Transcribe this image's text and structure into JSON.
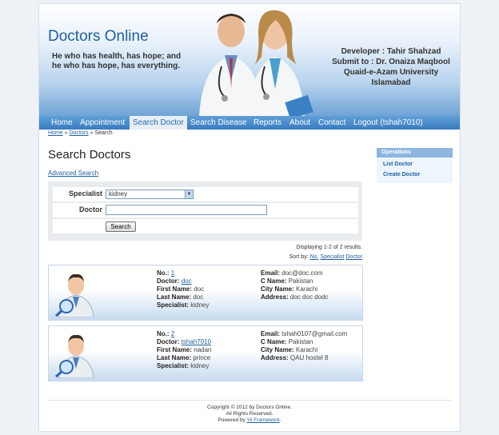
{
  "header": {
    "title": "Doctors Online",
    "motto_line1": "He who has health, has hope; and",
    "motto_line2": "he who has hope, has everything.",
    "developer": "Developer : Tahir Shahzad",
    "submit": "Submit to : Dr. Onaiza Maqbool",
    "university": "Quaid-e-Azam University",
    "city": "Islamabad"
  },
  "nav": [
    {
      "label": "Home"
    },
    {
      "label": "Appointment"
    },
    {
      "label": "Search Doctor",
      "active": true
    },
    {
      "label": "Search Disease"
    },
    {
      "label": "Reports"
    },
    {
      "label": "About"
    },
    {
      "label": "Contact"
    },
    {
      "label": "Logout (tshah7010)"
    }
  ],
  "breadcrumb": {
    "home": "Home",
    "sep1": "»",
    "doctors": "Doctors",
    "sep2": "»",
    "current": "Search"
  },
  "page_title": "Search Doctors",
  "advanced_search": "Advanced Search",
  "form": {
    "specialist_label": "Specialist",
    "specialist_value": "kidney",
    "doctor_label": "Doctor",
    "doctor_value": "",
    "search_button": "Search"
  },
  "summary": "Displaying 1-2 of 2 results.",
  "sort": {
    "label": "Sort by:",
    "options": [
      "No.",
      "Specialist",
      "Doctor"
    ]
  },
  "results": [
    {
      "no": "1",
      "doctor": "doc",
      "first_name": "doc",
      "last_name": "doc",
      "specialist": "kidney",
      "email": "doc@doc.com",
      "c_name": "Pakistan",
      "city_name": "Karachi",
      "address": "doc doc dodc"
    },
    {
      "no": "2",
      "doctor": "tshah7010",
      "first_name": "nadan",
      "last_name": "prince",
      "specialist": "kidney",
      "email": "tshah0107@gmail.com",
      "c_name": "Pakistan",
      "city_name": "Karachi",
      "address": "QAU hostel 8"
    }
  ],
  "field_labels": {
    "no": "No.:",
    "doctor": "Doctor:",
    "first_name": "First Name:",
    "last_name": "Last Name:",
    "specialist": "Specialist:",
    "email": "Email:",
    "c_name": "C Name:",
    "city_name": "City Name:",
    "address": "Address:"
  },
  "sidebar": {
    "title": "Operations",
    "items": [
      "List Doctor",
      "Create Doctor"
    ]
  },
  "footer": {
    "line1": "Copyright © 2012 by Doctors Online.",
    "line2": "All Rights Reserved.",
    "line3_prefix": "Powered by",
    "line3_link": "Yii Framework",
    "line3_suffix": "."
  },
  "colors": {
    "brand": "#1f5fa3",
    "nav": "#3a7bbf",
    "active_tab_bg": "#e7eef6"
  }
}
